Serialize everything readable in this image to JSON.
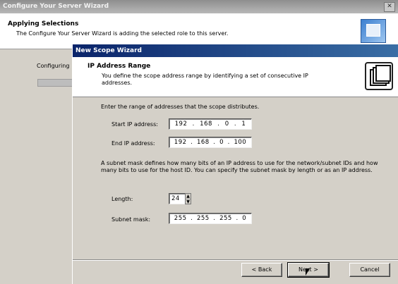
{
  "outer": {
    "window_title": "Configure Your Server Wizard",
    "close_glyph": "✕",
    "header_title": "Applying Selections",
    "header_subtitle": "The Configure Your Server Wizard is adding the selected role to this server.",
    "status_label": "Configuring"
  },
  "inner": {
    "window_title": "New Scope Wizard",
    "header_title": "IP Address Range",
    "header_subtitle": "You define the scope address range by identifying a set of consecutive IP addresses.",
    "intro": "Enter the range of addresses that the scope distributes.",
    "start_ip": {
      "label": "Start IP address:",
      "octets": [
        "192",
        "168",
        "0",
        "1"
      ]
    },
    "end_ip": {
      "label": "End IP address:",
      "octets": [
        "192",
        "168",
        "0",
        "100"
      ]
    },
    "subnet_paragraph": "A subnet mask defines how many bits of an IP address to use for the network/subnet IDs and how many bits to use for the host ID. You can specify the subnet mask by length or as an IP address.",
    "length": {
      "label": "Length:",
      "value": "24"
    },
    "subnet_mask": {
      "label": "Subnet mask:",
      "octets": [
        "255",
        "255",
        "255",
        "0"
      ]
    },
    "buttons": {
      "back": "< Back",
      "next": "Next >",
      "cancel": "Cancel"
    }
  }
}
